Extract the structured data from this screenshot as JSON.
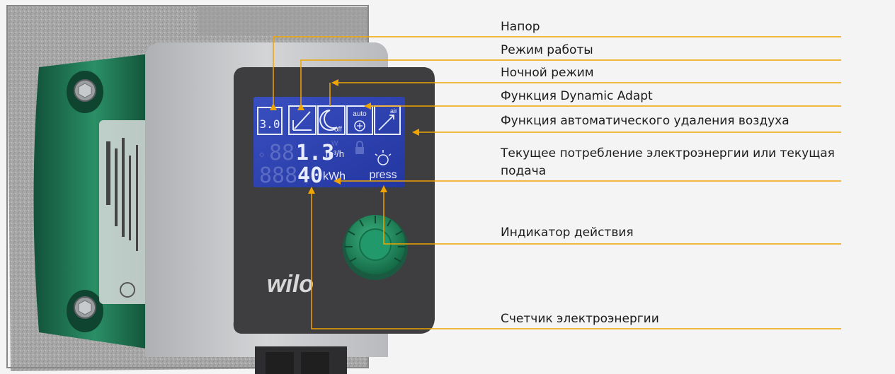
{
  "callouts": [
    {
      "id": "head",
      "label": "Напор"
    },
    {
      "id": "mode",
      "label": "Режим работы"
    },
    {
      "id": "night",
      "label": "Ночной режим"
    },
    {
      "id": "dynamic",
      "label": "Функция Dynamic Adapt"
    },
    {
      "id": "deair",
      "label": "Функция автоматического удаления воздуха"
    },
    {
      "id": "power",
      "label": "Текущее потребление электроэнергии или текущая подача"
    },
    {
      "id": "action",
      "label": "Индикатор действия"
    },
    {
      "id": "meter",
      "label": "Счетчик электроэнергии"
    }
  ],
  "display": {
    "head_value": "3.0",
    "night_label": "off",
    "auto_label": "auto",
    "deair_label": "air",
    "flow_value": "1.3",
    "flow_unit": "m³/h",
    "flow_unit_alt": "W",
    "energy_value": "40",
    "energy_unit": "kWh",
    "press_label": "press"
  },
  "brand": "wilo",
  "colors": {
    "line": "#f0a400",
    "lcd_bg": "#2a3ea8",
    "lcd_fg": "#e8ecff",
    "lcd_dim": "#5a6cc4",
    "pump_green": "#1e7a55",
    "knob_green": "#1f8a5e",
    "housing_dark": "#3d3d3f",
    "housing_light": "#c8c9cb",
    "insulation": "#a9a9a9"
  }
}
